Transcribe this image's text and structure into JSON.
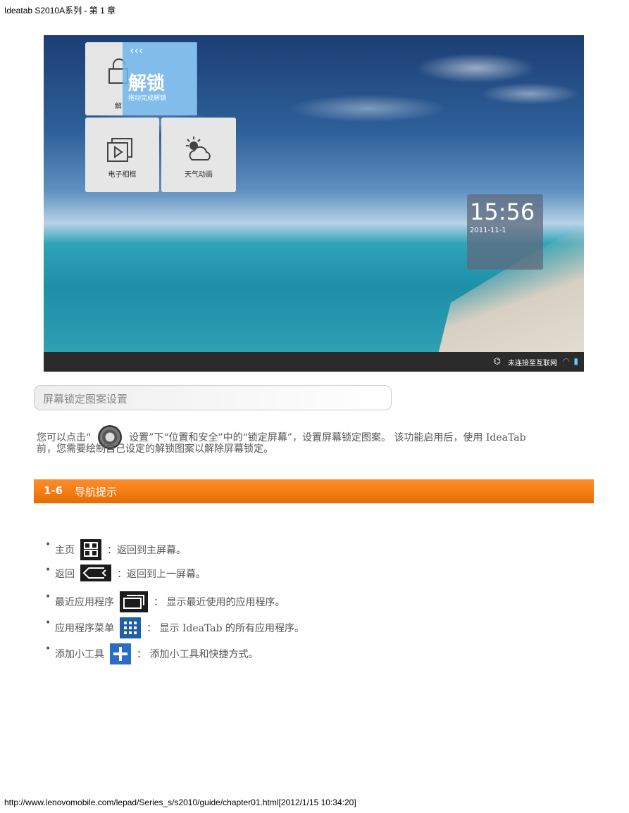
{
  "header": {
    "title": "Ideatab S2010A系列 - 第 1 章"
  },
  "screenshot": {
    "unlock_tile_label_partial": "解",
    "unlock_arrows": "‹‹‹",
    "unlock_title": "解锁",
    "unlock_subtitle": "拖动完成解锁",
    "photo_frame_label": "电子相框",
    "weather_label": "天气动画",
    "clock_time": "15:56",
    "clock_date": "2011-11-1",
    "status_text": "未连接至互联网"
  },
  "pattern_section": {
    "title": "屏幕锁定图案设置",
    "para_before": "您可以点击“",
    "para_after": "设置”下“位置和安全”中的“锁定屏幕”，设置屏幕锁定图案。 该功能启用后，使用 IdeaTab",
    "para_line2": "前，您需要绘制自己设定的解锁图案以解除屏幕锁定。"
  },
  "nav_section": {
    "number": "1-6",
    "title": "导航提示",
    "items": [
      {
        "label": "主页",
        "desc": "：返回到主屏幕。"
      },
      {
        "label": "返回",
        "desc": "：返回到上一屏幕。"
      },
      {
        "label": "最近应用程序",
        "desc": "： 显示最近使用的应用程序。"
      },
      {
        "label": "应用程序菜单",
        "desc": "： 显示 IdeaTab 的所有应用程序。"
      },
      {
        "label": "添加小工具",
        "desc": "： 添加小工具和快捷方式。"
      }
    ]
  },
  "footer": {
    "url": "http://www.lenovomobile.com/lepad/Series_s/s2010/guide/chapter01.html[2012/1/15 10:34:20]"
  }
}
